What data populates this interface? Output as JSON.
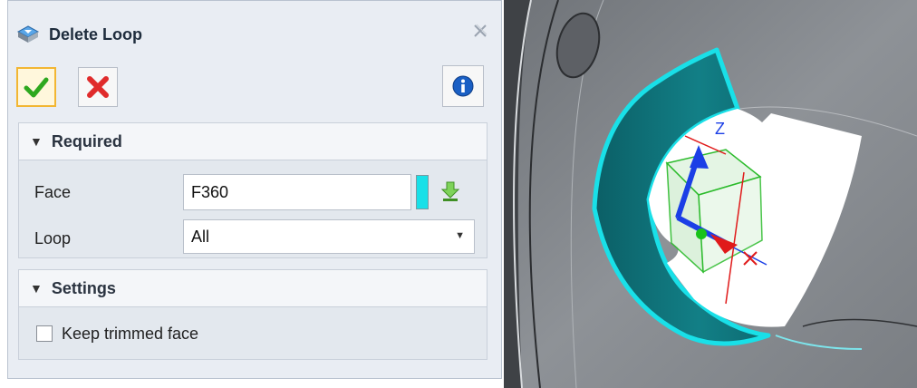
{
  "dialog": {
    "title": "Delete Loop",
    "close_icon": "close-icon",
    "ok_icon": "check-icon",
    "cancel_icon": "x-icon",
    "info_icon": "info-icon"
  },
  "required": {
    "header": "Required",
    "face_label": "Face",
    "face_value": "F360",
    "loop_label": "Loop",
    "loop_value": "All"
  },
  "settings": {
    "header": "Settings",
    "keep_trimmed_label": "Keep trimmed face",
    "keep_trimmed_checked": false
  },
  "viewport": {
    "triad_z_label": "Z",
    "highlight_color": "#19e0e8",
    "axis_z_color": "#1b3fe6",
    "axis_x_color": "#e01a1a",
    "axis_y_color": "#19c21a"
  }
}
